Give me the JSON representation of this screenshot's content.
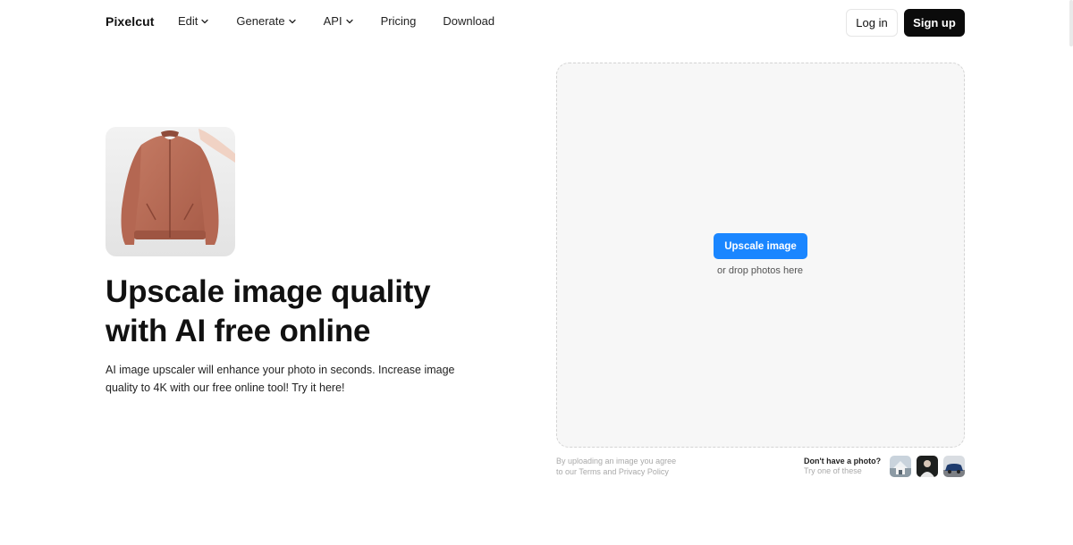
{
  "header": {
    "logo": "Pixelcut",
    "nav": [
      {
        "label": "Edit",
        "has_dropdown": true
      },
      {
        "label": "Generate",
        "has_dropdown": true
      },
      {
        "label": "API",
        "has_dropdown": true
      },
      {
        "label": "Pricing",
        "has_dropdown": false
      },
      {
        "label": "Download",
        "has_dropdown": false
      }
    ],
    "login_label": "Log in",
    "signup_label": "Sign up"
  },
  "hero": {
    "image_icon": "jacket-photo",
    "title_line1": "Upscale image quality",
    "title_line2": "with AI free online",
    "description": "AI image upscaler will enhance your photo in seconds. Increase image quality to 4K with our free online tool! Try it here!"
  },
  "upload": {
    "button_label": "Upscale image",
    "drop_text": "or drop photos here",
    "terms_line1": "By uploading an image you agree",
    "terms_line2": "to our Terms and Privacy Policy",
    "try_title": "Don't have a photo?",
    "try_subtitle": "Try one of these",
    "samples": [
      "sample-house-photo",
      "sample-person-photo",
      "sample-car-photo"
    ]
  },
  "colors": {
    "accent": "#1a86ff",
    "signup_bg": "#0b0b0b",
    "dropzone_bg": "#f7f7f7",
    "jacket": "#b66a55"
  }
}
